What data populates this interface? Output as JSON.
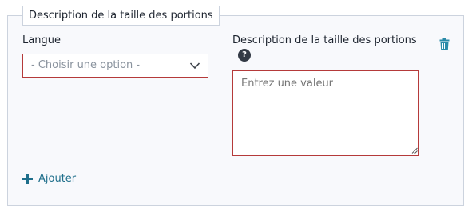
{
  "fieldset": {
    "legend": "Description de la taille des portions"
  },
  "language_field": {
    "label": "Langue",
    "select_value": "- Choisir une option -"
  },
  "description_field": {
    "label": "Description de la taille des portions",
    "placeholder": "Entrez une valeur",
    "help_icon": "?"
  },
  "actions": {
    "add_label": "Ajouter"
  },
  "icons": {
    "chevron": "chevron-down-icon",
    "help": "question-circle-icon",
    "trash": "trash-icon",
    "plus": "plus-icon"
  },
  "colors": {
    "accent": "#1f6f8b",
    "error_border": "#b53a3a",
    "panel_bg": "#f8f9fc",
    "border": "#ccd3de"
  }
}
